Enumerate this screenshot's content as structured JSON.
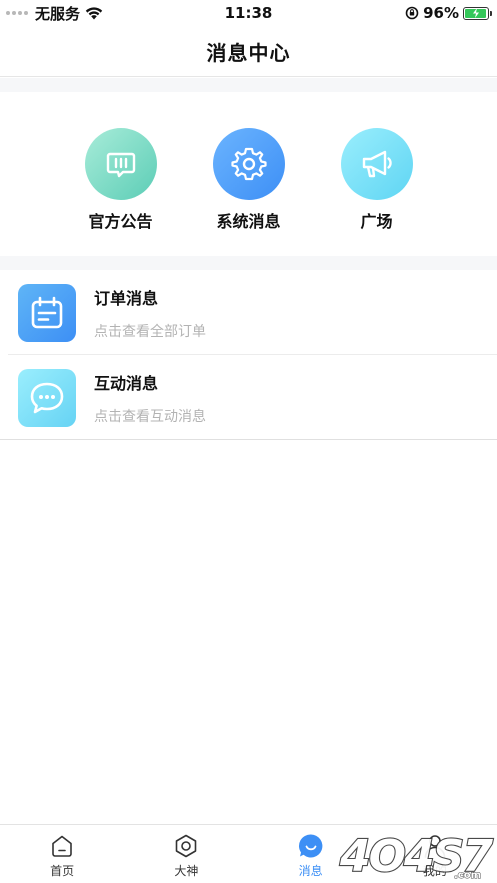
{
  "status_bar": {
    "carrier": "无服务",
    "time": "11:38",
    "battery": "96%",
    "battery_level": 0.96
  },
  "header": {
    "title": "消息中心"
  },
  "categories": [
    {
      "label": "官方公告",
      "icon": "announcement-icon",
      "color_from": "#a8ecd9",
      "color_to": "#5ccdb6"
    },
    {
      "label": "系统消息",
      "icon": "gear-icon",
      "color_from": "#6bb4ff",
      "color_to": "#3d8ff5"
    },
    {
      "label": "广场",
      "icon": "megaphone-icon",
      "color_from": "#9aeefd",
      "color_to": "#5fd5f3"
    }
  ],
  "messages": [
    {
      "title": "订单消息",
      "subtitle": "点击查看全部订单",
      "icon": "calendar-icon"
    },
    {
      "title": "互动消息",
      "subtitle": "点击查看互动消息",
      "icon": "chat-bubble-icon"
    }
  ],
  "tabs": [
    {
      "label": "首页",
      "icon": "home-icon",
      "active": false
    },
    {
      "label": "大神",
      "icon": "hexagon-icon",
      "active": false
    },
    {
      "label": "消息",
      "icon": "message-icon",
      "active": true
    },
    {
      "label": "我的",
      "icon": "person-icon",
      "active": false
    }
  ],
  "colors": {
    "accent": "#3d8ff5",
    "subtitle_gray": "#b3b3b3"
  },
  "watermark": "4O4S7.com"
}
